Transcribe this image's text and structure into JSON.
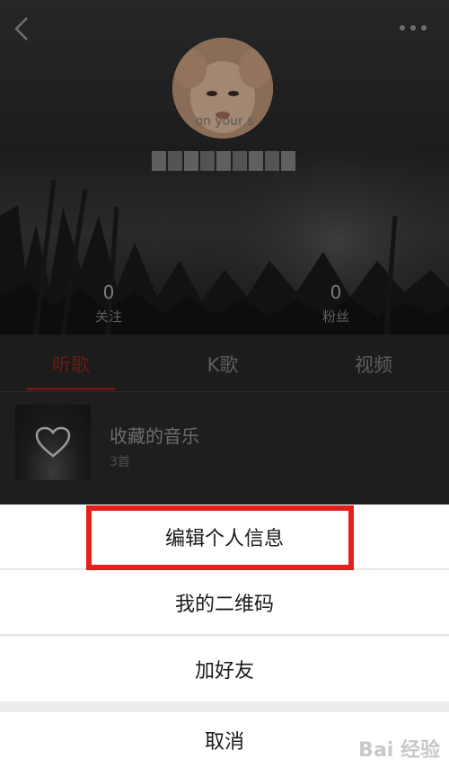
{
  "profile": {
    "avatar_caption": "on your s",
    "stats": [
      {
        "value": "0",
        "label": "关注"
      },
      {
        "value": "0",
        "label": "粉丝"
      }
    ]
  },
  "tabs": [
    {
      "label": "听歌",
      "active": true
    },
    {
      "label": "K歌",
      "active": false
    },
    {
      "label": "视频",
      "active": false
    }
  ],
  "playlist": {
    "title": "收藏的音乐",
    "count": "3首"
  },
  "action_sheet": {
    "items": [
      "编辑个人信息",
      "我的二维码",
      "加好友"
    ],
    "cancel": "取消"
  },
  "watermark": "Bai 经验",
  "colors": {
    "accent": "#e5201c",
    "active_tab": "#6a1a14",
    "sheet_bg": "#ececec"
  },
  "icons": [
    "back-icon",
    "more-icon",
    "heart-icon"
  ]
}
